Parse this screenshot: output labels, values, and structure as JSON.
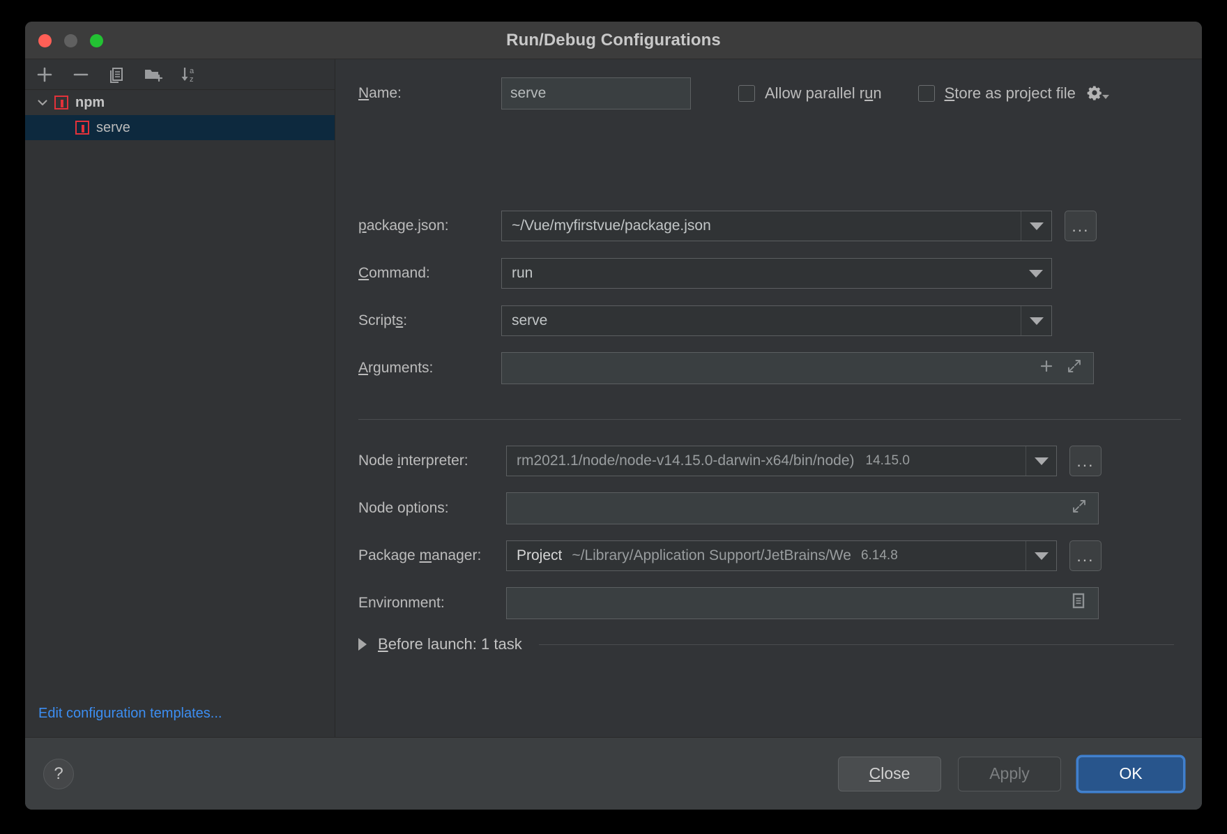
{
  "window": {
    "title": "Run/Debug Configurations",
    "traffic_lights": [
      "close",
      "minimize",
      "zoom"
    ]
  },
  "left_panel": {
    "toolbar": [
      {
        "name": "add",
        "glyph": "+"
      },
      {
        "name": "remove",
        "glyph": "−"
      },
      {
        "name": "copy",
        "glyph": "copy-icon"
      },
      {
        "name": "save-configuration",
        "glyph": "folder-add-icon"
      },
      {
        "name": "sort-alphabetically",
        "glyph": "sort-az-icon"
      }
    ],
    "tree": [
      {
        "label": "npm",
        "level": 0,
        "icon": "npm-icon",
        "expanded": true,
        "selected": false
      },
      {
        "label": "serve",
        "level": 1,
        "icon": "npm-icon",
        "selected": true
      }
    ],
    "edit_templates_link": "Edit configuration templates..."
  },
  "form": {
    "name_label": "Name:",
    "name_label_mnemonic": "N",
    "name_value": "serve",
    "allow_parallel_run": {
      "label": "Allow parallel run",
      "mnemonic": "u",
      "checked": false
    },
    "store_as_project_file": {
      "label": "Store as project file",
      "mnemonic": "S",
      "checked": false,
      "gear_icon": "gear-icon"
    },
    "package_json": {
      "label": "package.json:",
      "mnemonic": "p",
      "value": "~/Vue/myfirstvue/package.json",
      "browse_label": "..."
    },
    "command": {
      "label": "Command:",
      "mnemonic": "C",
      "value": "run"
    },
    "scripts": {
      "label": "Scripts:",
      "mnemonic": "s",
      "value": "serve"
    },
    "arguments": {
      "label": "Arguments:",
      "mnemonic": "A",
      "value": "",
      "add_icon": "plus-icon",
      "expand_icon": "expand-icon"
    },
    "node_interpreter": {
      "label": "Node interpreter:",
      "mnemonic": "i",
      "value": "rm2021.1/node/node-v14.15.0-darwin-x64/bin/node)",
      "version": "14.15.0",
      "browse_label": "..."
    },
    "node_options": {
      "label": "Node options:",
      "value": "",
      "expand_icon": "expand-icon"
    },
    "package_manager": {
      "label": "Package manager:",
      "mnemonic": "m",
      "value": "Project",
      "path": "~/Library/Application Support/JetBrains/We",
      "version": "6.14.8",
      "browse_label": "..."
    },
    "environment": {
      "label": "Environment:",
      "value": "",
      "list_icon": "list-document-icon"
    },
    "before_launch": {
      "label": "Before launch: 1 task",
      "mnemonic": "B",
      "expanded": false
    }
  },
  "footer": {
    "help_label": "?",
    "close_label": "Close",
    "close_mnemonic": "C",
    "apply_label": "Apply",
    "apply_enabled": false,
    "ok_label": "OK",
    "ok_is_default": true
  },
  "colors": {
    "window_bg": "#3c3f41",
    "panel_bg": "#323437",
    "selection_blue": "#0d293e",
    "link_blue": "#3c8ef2",
    "npm_red": "#e2323a",
    "default_button_blue": "#28558c"
  }
}
